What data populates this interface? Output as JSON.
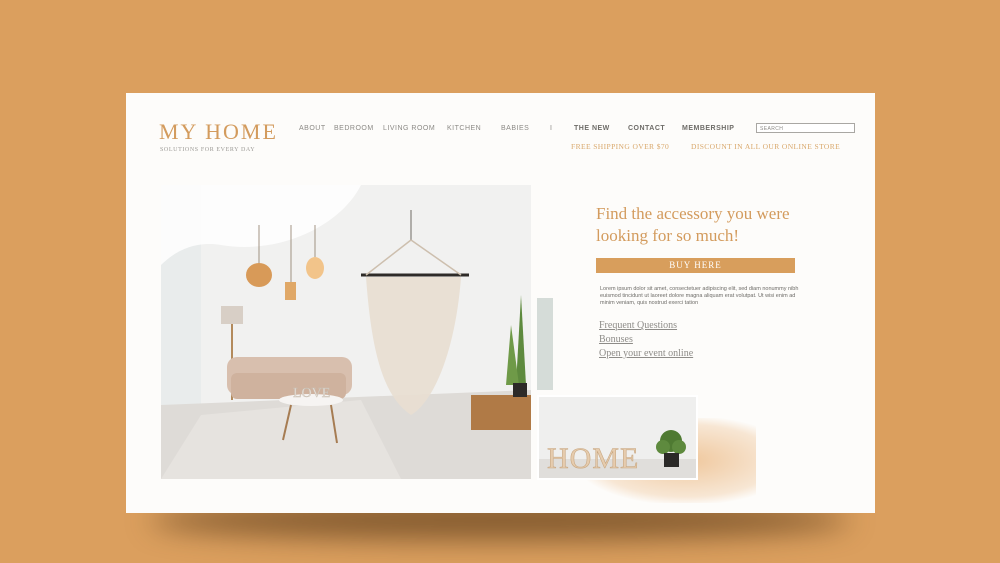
{
  "brand": {
    "logo": "MY HOME",
    "tagline": "SOLUTIONS FOR EVERY DAY"
  },
  "nav": {
    "items": [
      "ABOUT",
      "BEDROOM",
      "LIVING ROOM",
      "KITCHEN",
      "BABIES",
      "I",
      "THE NEW",
      "CONTACT",
      "MEMBERSHIP"
    ]
  },
  "search": {
    "placeholder": "SEARCH"
  },
  "promos": {
    "shipping": "FREE SHIPPING OVER $70",
    "discount": "DISCOUNT IN ALL OUR ONLINE STORE"
  },
  "hero": {
    "headline": "Find the accessory you were looking for so much!",
    "buy_label": "BUY HERE",
    "body": "Lorem ipsum dolor sit amet, consectetuer adipiscing elit, sed diam nonummy nibh euismod tincidunt ut laoreet dolore magna aliquam erat volutpat. Ut wisi enim ad minim veniam, quis nostrud exerci tation",
    "links": [
      "Frequent Questions",
      "Bonuses",
      "Open your event online"
    ]
  },
  "images": {
    "small_sign": "HOME",
    "main_sign": "LOVE"
  },
  "colors": {
    "background": "#DB9F5E",
    "accent": "#D39B5D",
    "button": "#D89E5C",
    "page": "#FDFCFA"
  }
}
